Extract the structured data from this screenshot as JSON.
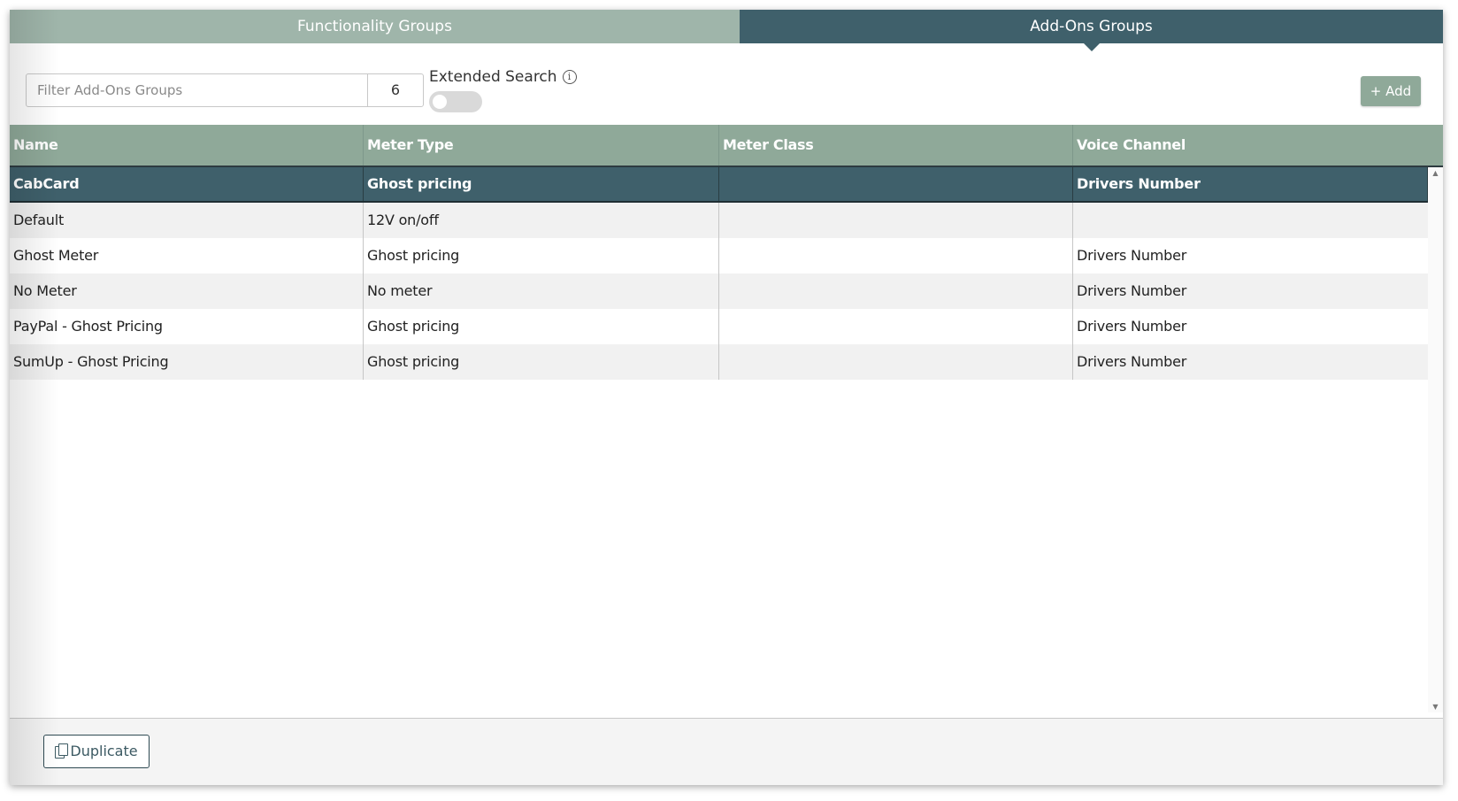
{
  "tabs": {
    "functionality": "Functionality Groups",
    "addons": "Add-Ons Groups"
  },
  "toolbar": {
    "filter_placeholder": "Filter Add-Ons Groups",
    "filter_value": "",
    "count": "6",
    "extended_search_label": "Extended Search",
    "extended_search_on": false,
    "add_label": "+ Add"
  },
  "table": {
    "columns": [
      "Name",
      "Meter Type",
      "Meter Class",
      "Voice Channel"
    ],
    "rows": [
      {
        "name": "CabCard",
        "meter_type": "Ghost pricing",
        "meter_class": "",
        "voice_channel": "Drivers Number"
      },
      {
        "name": "Default",
        "meter_type": "12V on/off",
        "meter_class": "",
        "voice_channel": ""
      },
      {
        "name": "Ghost Meter",
        "meter_type": "Ghost pricing",
        "meter_class": "",
        "voice_channel": "Drivers Number"
      },
      {
        "name": "No Meter",
        "meter_type": "No meter",
        "meter_class": "",
        "voice_channel": "Drivers Number"
      },
      {
        "name": "PayPal - Ghost Pricing",
        "meter_type": "Ghost pricing",
        "meter_class": "",
        "voice_channel": "Drivers Number"
      },
      {
        "name": "SumUp - Ghost Pricing",
        "meter_type": "Ghost pricing",
        "meter_class": "",
        "voice_channel": "Drivers Number"
      }
    ]
  },
  "footer": {
    "duplicate_label": "Duplicate"
  },
  "icons": {
    "info": "info-icon",
    "copy": "copy-icon"
  },
  "colors": {
    "tab_active": "#3f606b",
    "tab_inactive": "#9fb5aa",
    "header_bg": "#8fa999",
    "selected_row": "#3f606b",
    "add_button": "#8fa999"
  }
}
